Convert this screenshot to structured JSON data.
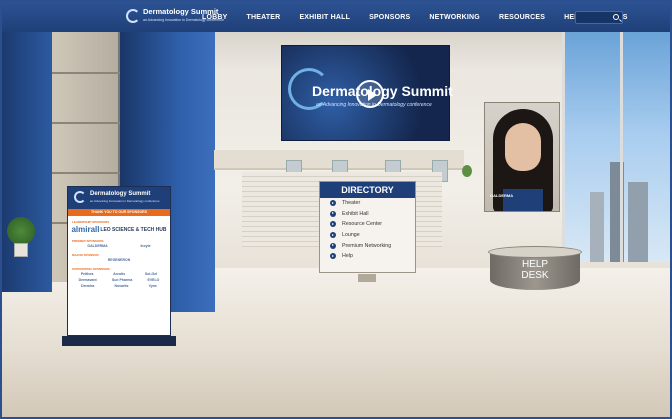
{
  "nav": {
    "logo_title": "Dermatology Summit",
    "logo_subtitle": "an Advancing Innovation in Dermatology conference",
    "items": [
      "LOBBY",
      "THEATER",
      "EXHIBIT HALL",
      "SPONSORS",
      "NETWORKING",
      "RESOURCES",
      "HELP",
      "TOOLS"
    ],
    "search_placeholder": ""
  },
  "banner": {
    "title": "Dermatology Summit",
    "subtitle": "an Advancing Innovation in Dermatology conference"
  },
  "portrait": {
    "brand": "GALDERMA"
  },
  "directory": {
    "title": "DIRECTORY",
    "entries": [
      "Theater",
      "Exhibit Hall",
      "Resource Center",
      "Lounge",
      "Premium Networking",
      "Help"
    ]
  },
  "help_desk": {
    "label_line1": "HELP",
    "label_line2": "DESK"
  },
  "sponsor_board": {
    "title": "Dermatology Summit",
    "subtitle": "an Advancing Innovation in Dermatology conference",
    "thanks": "THANK YOU TO OUR SPONSORS",
    "tiers": [
      {
        "name": "LEADERSHIP SPONSORS",
        "logos": [
          "almirall",
          "LEO SCIENCE & TECH HUB"
        ]
      },
      {
        "name": "PREMIER SPONSORS",
        "logos": [
          "GALDERMA",
          "Incyte"
        ]
      },
      {
        "name": "MAJOR SPONSOR",
        "logos": [
          "REGENERON"
        ]
      },
      {
        "name": "SUPPORTING SPONSORS",
        "logos": [
          "Pelthos",
          "Arcutis",
          "Sol-Gel",
          "Dermavant",
          "Sun Pharma",
          "EVELO",
          "Dermira",
          "Novartis",
          "Vyne"
        ]
      }
    ]
  },
  "colors": {
    "nav": "#1f3f78",
    "accent": "#e86a1c"
  }
}
